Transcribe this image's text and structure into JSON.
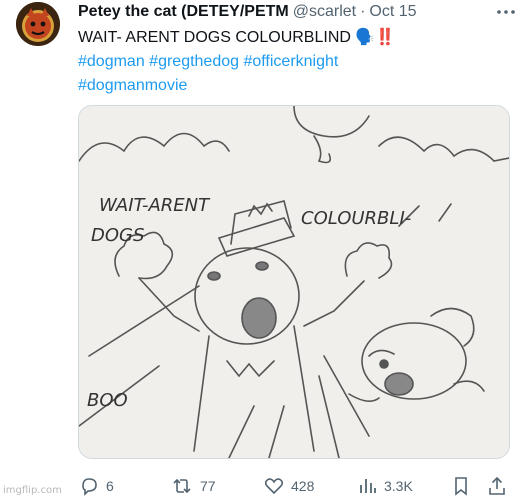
{
  "tweet": {
    "display_name": "Petey the cat (DETEY/PETM",
    "handle": "@scarlet",
    "separator": "·",
    "timestamp": "Oct 15",
    "text": "WAIT- ARENT DOGS COLOURBLIND",
    "emojis": "🗣️‼️",
    "hashtags_line1": "#dogman #gregthedog #officerknight",
    "hashtags_line2": "#dogmanmovie"
  },
  "media": {
    "drawing_text": {
      "wait_arent": "WAIT-ARENT",
      "dogs": "DOGS",
      "colourbli": "COLOURBLI-",
      "boo": "BOO"
    }
  },
  "actions": {
    "replies": "6",
    "reposts": "77",
    "likes": "428",
    "views": "3.3K"
  },
  "icons": {
    "reply": "reply-icon",
    "repost": "repost-icon",
    "like": "heart-icon",
    "views": "views-chart-icon",
    "bookmark": "bookmark-icon",
    "share": "share-icon",
    "more": "more-icon"
  },
  "watermark": "imgflip.com",
  "colors": {
    "link": "#1d9bf0",
    "muted": "#536471",
    "text": "#0f1419",
    "emoji_red": "#e0245e"
  }
}
